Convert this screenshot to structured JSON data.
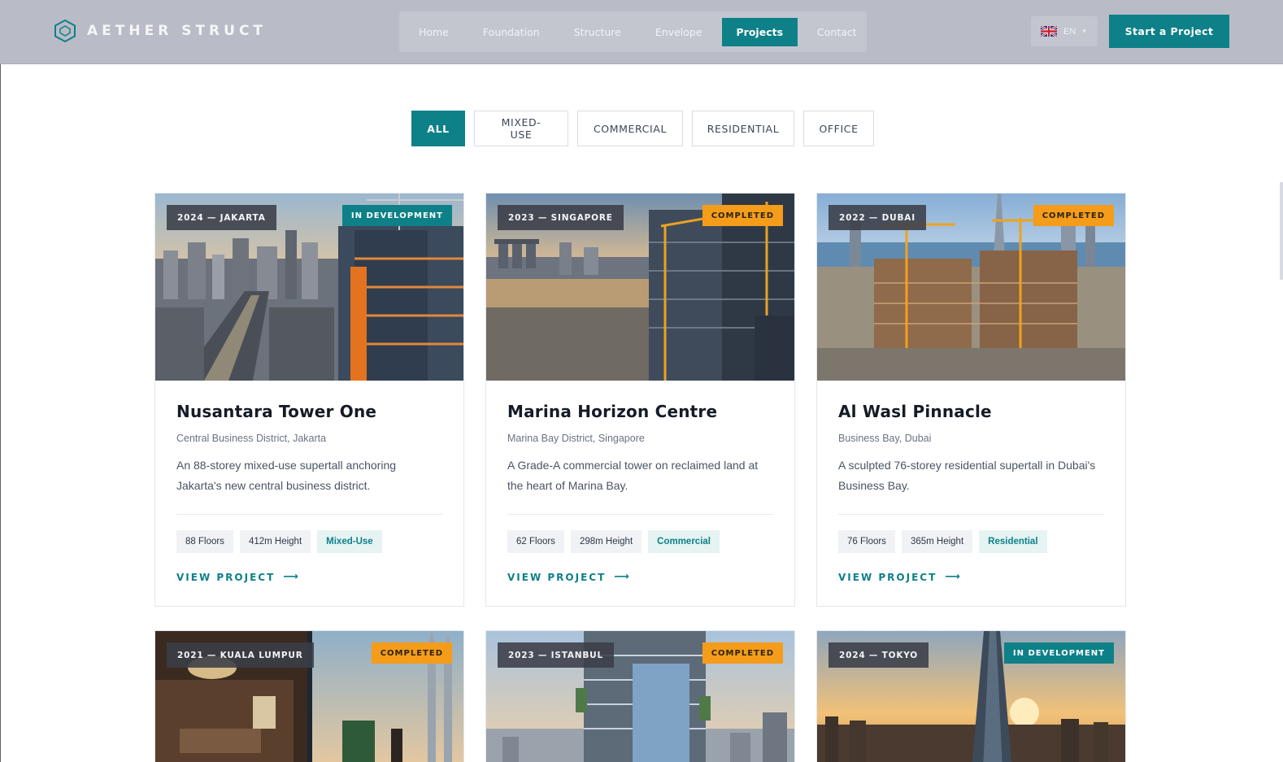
{
  "brand": {
    "name": "AETHER STRUCT"
  },
  "nav": {
    "items": [
      "Home",
      "Foundation",
      "Structure",
      "Envelope",
      "Projects",
      "Contact"
    ],
    "active_index": 4
  },
  "language": {
    "code": "EN"
  },
  "cta": {
    "label": "Start a Project"
  },
  "filters": {
    "items": [
      "ALL",
      "MIXED-USE",
      "COMMERCIAL",
      "RESIDENTIAL",
      "OFFICE"
    ],
    "active_index": 0
  },
  "colors": {
    "accent": "#0e8088",
    "completed": "#f59c1a",
    "header": "#b9bcc6"
  },
  "projects": [
    {
      "year_city": "2024 — JAKARTA",
      "status": "IN DEVELOPMENT",
      "title": "Nusantara Tower One",
      "location": "Central Business District, Jakarta",
      "desc": "An 88-storey mixed-use supertall anchoring Jakarta's new central business district.",
      "floors": "88 Floors",
      "height": "412m Height",
      "type": "Mixed-Use",
      "link": "VIEW PROJECT"
    },
    {
      "year_city": "2023 — SINGAPORE",
      "status": "COMPLETED",
      "title": "Marina Horizon Centre",
      "location": "Marina Bay District, Singapore",
      "desc": "A Grade-A commercial tower on reclaimed land at the heart of Marina Bay.",
      "floors": "62 Floors",
      "height": "298m Height",
      "type": "Commercial",
      "link": "VIEW PROJECT"
    },
    {
      "year_city": "2022 — DUBAI",
      "status": "COMPLETED",
      "title": "Al Wasl Pinnacle",
      "location": "Business Bay, Dubai",
      "desc": "A sculpted 76-storey residential supertall in Dubai's Business Bay.",
      "floors": "76 Floors",
      "height": "365m Height",
      "type": "Residential",
      "link": "VIEW PROJECT"
    },
    {
      "year_city": "2021 — KUALA LUMPUR",
      "status": "COMPLETED"
    },
    {
      "year_city": "2023 — ISTANBUL",
      "status": "COMPLETED"
    },
    {
      "year_city": "2024 — TOKYO",
      "status": "IN DEVELOPMENT"
    }
  ]
}
